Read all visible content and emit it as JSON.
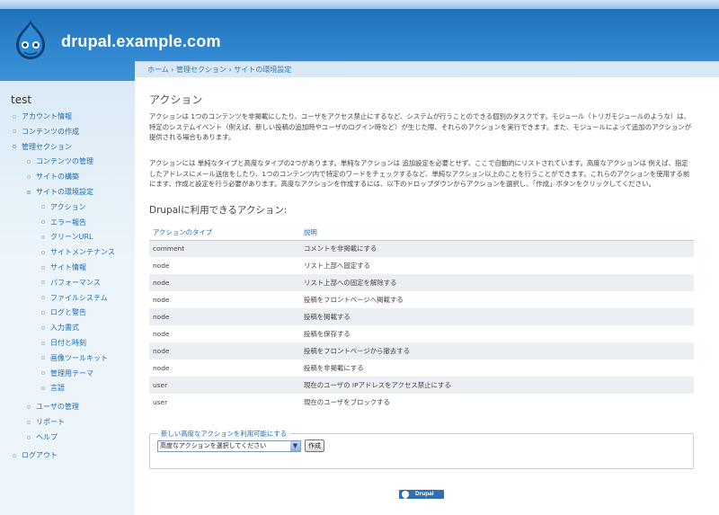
{
  "site": {
    "name": "drupal.example.com"
  },
  "sidebar": {
    "user": "test",
    "items": [
      {
        "label": "アカウント情報",
        "level": 0
      },
      {
        "label": "コンテンツの作成",
        "level": 0
      },
      {
        "label": "管理セクション",
        "level": 0
      },
      {
        "label": "コンテンツの管理",
        "level": 1
      },
      {
        "label": "サイトの構築",
        "level": 1
      },
      {
        "label": "サイトの環境設定",
        "level": 1
      },
      {
        "label": "アクション",
        "level": 2
      },
      {
        "label": "エラー報告",
        "level": 2
      },
      {
        "label": "クリーンURL",
        "level": 2
      },
      {
        "label": "サイトメンテナンス",
        "level": 2
      },
      {
        "label": "サイト情報",
        "level": 2
      },
      {
        "label": "パフォーマンス",
        "level": 2
      },
      {
        "label": "ファイルシステム",
        "level": 2
      },
      {
        "label": "ログと警告",
        "level": 2
      },
      {
        "label": "入力書式",
        "level": 2
      },
      {
        "label": "日付と時刻",
        "level": 2
      },
      {
        "label": "画像ツールキット",
        "level": 2
      },
      {
        "label": "管理用テーマ",
        "level": 2
      },
      {
        "label": "言語",
        "level": 2
      },
      {
        "label": "ユーザの管理",
        "level": 1
      },
      {
        "label": "リポート",
        "level": 1
      },
      {
        "label": "ヘルプ",
        "level": 1
      },
      {
        "label": "ログアウト",
        "level": 0
      }
    ]
  },
  "breadcrumb": "ホーム › 管理セクション › サイトの環境設定",
  "page": {
    "title": "アクション",
    "intro1": "アクションは 1つのコンテンツを非掲載にしたり、ユーザをアクセス禁止にするなど、システムが行うことのできる個別のタスクです。モジュール（トリガモジュールのような）は、特定のシステムイベント（例えば、新しい投稿の追加時やユーザのログイン時など）が生じた際、それらのアクションを実行できます。また、モジュールによって追加のアクションが提供される場合もあります。",
    "intro2": "アクションには 単純なタイプと高度なタイプの2つがあります。単純なアクションは 追加設定を必要とせず、ここで自動的にリストされています。高度なアクションは 例えば、指定したアドレスにメール送信をしたり、1つのコンテンツ内で特定のワードをチェックするなど、単純なアクション以上のことを行うことができます。これらのアクションを使用する前にます、作成と設定を行う必要があります。高度なアクションを作成するには、以下のドロップダウンからアクションを選択し、「作成」ボタンをクリックしてください。",
    "available_heading": "Drupalに利用できるアクション:"
  },
  "actions_table": {
    "headers": [
      "アクションのタイプ",
      "説明"
    ],
    "rows": [
      [
        "comment",
        "コメントを非掲載にする"
      ],
      [
        "node",
        "リスト上部へ固定する"
      ],
      [
        "node",
        "リスト上部への固定を解除する"
      ],
      [
        "node",
        "投稿をフロントページへ掲載する"
      ],
      [
        "node",
        "投稿を掲載する"
      ],
      [
        "node",
        "投稿を保存する"
      ],
      [
        "node",
        "投稿をフロントページから撤去する"
      ],
      [
        "node",
        "投稿を非掲載にする"
      ],
      [
        "user",
        "現在のユーザの IPアドレスをアクセス禁止にする"
      ],
      [
        "user",
        "現在のユーザをブロックする"
      ]
    ]
  },
  "new_action": {
    "legend": "新しい高度なアクションを利用可能にする",
    "select_value": "高度なアクションを選択してください",
    "create_label": "作成"
  },
  "footer": {
    "powered_label": "Drupal"
  },
  "colors": {
    "link": "#1d6cb4",
    "header": "#2f86cf",
    "row_even": "#ebeff3"
  }
}
